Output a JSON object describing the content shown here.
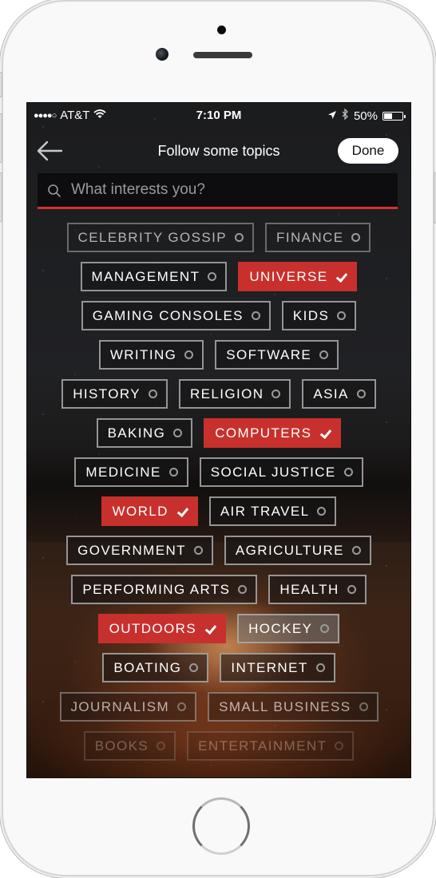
{
  "status_bar": {
    "carrier": "AT&T",
    "signal_dots": "●●●●○",
    "time": "7:10 PM",
    "battery_percent": "50%",
    "battery_level": 0.5,
    "icons": [
      "signal-icon",
      "wifi-icon",
      "location-icon",
      "bluetooth-icon",
      "battery-icon"
    ]
  },
  "nav": {
    "back_icon": "arrow-left-icon",
    "title": "Follow some topics",
    "done_label": "Done"
  },
  "search": {
    "icon": "search-icon",
    "placeholder": "What interests you?",
    "value": ""
  },
  "colors": {
    "accent": "#c8302d",
    "search_underline": "#d2332f",
    "chip_border": "#aaaaaa",
    "text": "#ffffff"
  },
  "topic_rows": [
    {
      "style": "dim",
      "chips": [
        {
          "label": "CELEBRITY GOSSIP",
          "selected": false
        },
        {
          "label": "FINANCE",
          "selected": false
        }
      ]
    },
    {
      "style": "",
      "chips": [
        {
          "label": "MANAGEMENT",
          "selected": false
        },
        {
          "label": "UNIVERSE",
          "selected": true
        }
      ]
    },
    {
      "style": "",
      "chips": [
        {
          "label": "GAMING CONSOLES",
          "selected": false
        },
        {
          "label": "KIDS",
          "selected": false
        }
      ]
    },
    {
      "style": "",
      "chips": [
        {
          "label": "WRITING",
          "selected": false
        },
        {
          "label": "SOFTWARE",
          "selected": false
        }
      ]
    },
    {
      "style": "",
      "chips": [
        {
          "label": "HISTORY",
          "selected": false
        },
        {
          "label": "RELIGION",
          "selected": false
        },
        {
          "label": "ASIA",
          "selected": false
        }
      ]
    },
    {
      "style": "",
      "chips": [
        {
          "label": "BAKING",
          "selected": false
        },
        {
          "label": "COMPUTERS",
          "selected": true
        }
      ]
    },
    {
      "style": "",
      "chips": [
        {
          "label": "MEDICINE",
          "selected": false
        },
        {
          "label": "SOCIAL JUSTICE",
          "selected": false
        }
      ]
    },
    {
      "style": "",
      "chips": [
        {
          "label": "WORLD",
          "selected": true
        },
        {
          "label": "AIR TRAVEL",
          "selected": false
        }
      ]
    },
    {
      "style": "",
      "chips": [
        {
          "label": "GOVERNMENT",
          "selected": false
        },
        {
          "label": "AGRICULTURE",
          "selected": false
        }
      ]
    },
    {
      "style": "",
      "chips": [
        {
          "label": "PERFORMING ARTS",
          "selected": false
        },
        {
          "label": "HEALTH",
          "selected": false
        }
      ]
    },
    {
      "style": "",
      "chips": [
        {
          "label": "OUTDOORS",
          "selected": true
        },
        {
          "label": "HOCKEY",
          "selected": false,
          "highlighted": true
        }
      ]
    },
    {
      "style": "",
      "chips": [
        {
          "label": "BOATING",
          "selected": false
        },
        {
          "label": "INTERNET",
          "selected": false
        }
      ]
    },
    {
      "style": "fade1",
      "chips": [
        {
          "label": "JOURNALISM",
          "selected": false
        },
        {
          "label": "SMALL BUSINESS",
          "selected": false
        }
      ]
    },
    {
      "style": "fade2",
      "chips": [
        {
          "label": "BOOKS",
          "selected": false
        },
        {
          "label": "ENTERTAINMENT",
          "selected": false
        }
      ]
    }
  ]
}
